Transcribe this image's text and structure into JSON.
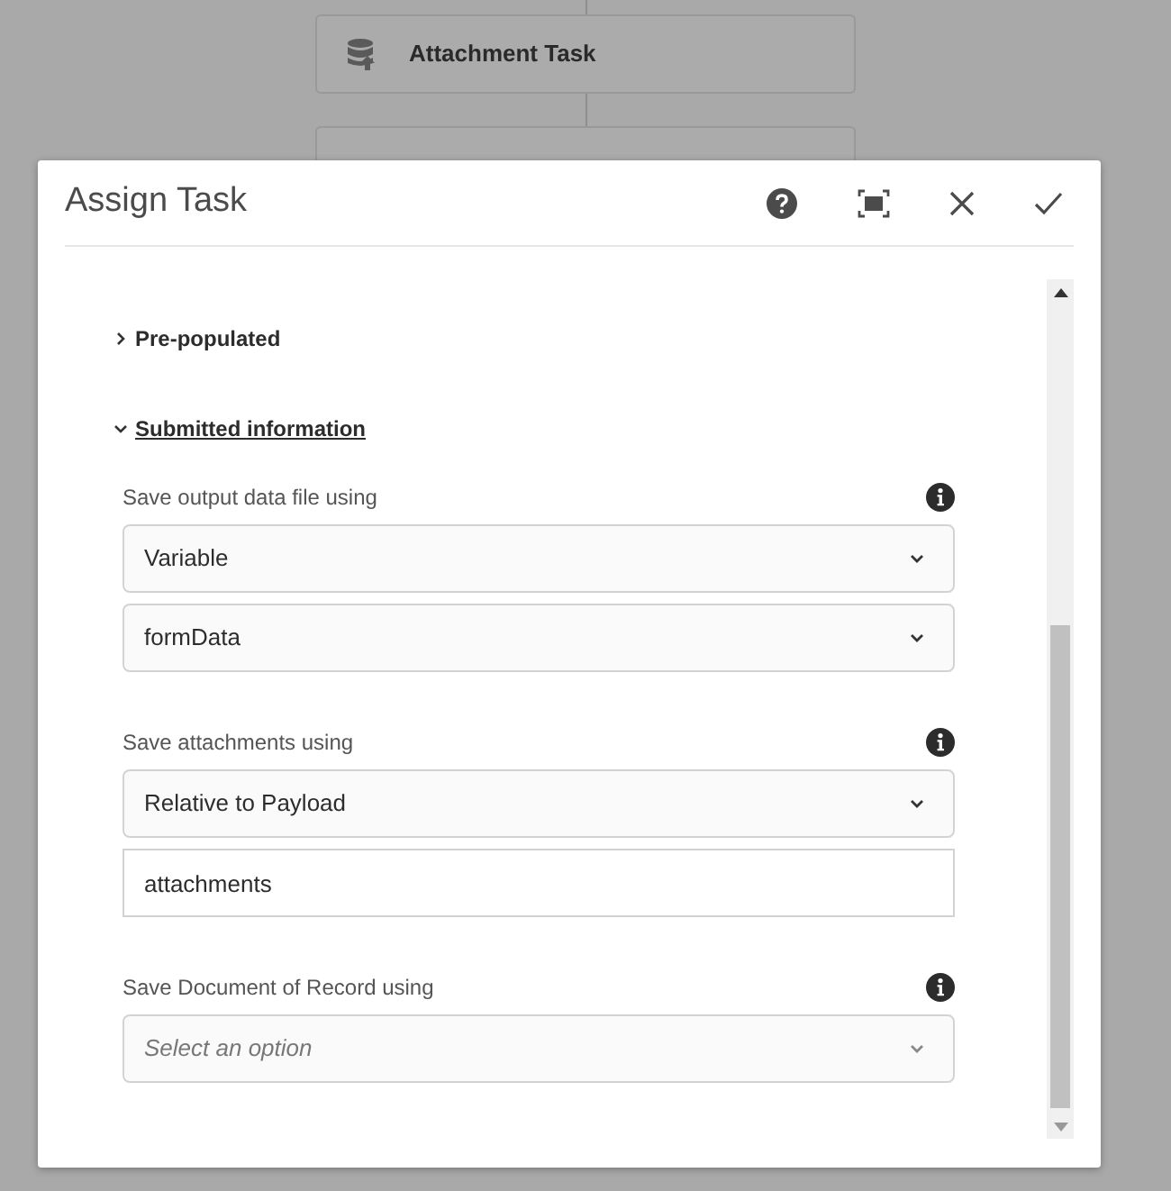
{
  "background_steps": [
    {
      "label": "Attachment Task"
    }
  ],
  "dialog": {
    "title": "Assign Task"
  },
  "sections": [
    {
      "label": "Pre-populated",
      "expanded": false
    },
    {
      "label": "Submitted information",
      "expanded": true
    }
  ],
  "fields": [
    {
      "label": "Save output data file using",
      "controls": [
        {
          "kind": "select",
          "value": "Variable"
        },
        {
          "kind": "select",
          "value": "formData"
        }
      ]
    },
    {
      "label": "Save attachments using",
      "controls": [
        {
          "kind": "select",
          "value": "Relative to Payload"
        },
        {
          "kind": "text",
          "value": "attachments"
        }
      ]
    },
    {
      "label": "Save Document of Record using",
      "controls": [
        {
          "kind": "select",
          "placeholder": "Select an option"
        }
      ]
    }
  ]
}
